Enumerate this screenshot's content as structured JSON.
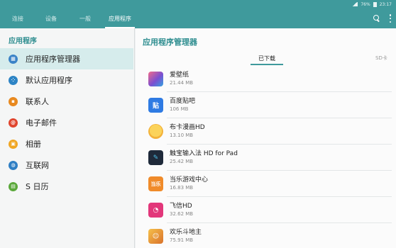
{
  "statusbar": {
    "time": "23:17",
    "battery": "76%"
  },
  "header": {
    "tabs": [
      {
        "label": "连接",
        "active": false
      },
      {
        "label": "设备",
        "active": false
      },
      {
        "label": "一般",
        "active": false
      },
      {
        "label": "应用程序",
        "active": true
      }
    ],
    "search_icon": "search-icon",
    "more_icon": "more-vertical-icon"
  },
  "left": {
    "title": "应用程序",
    "items": [
      {
        "label": "应用程序管理器",
        "icon": "grid-icon",
        "color": "#3b83c7",
        "selected": true
      },
      {
        "label": "默认应用程序",
        "icon": "apps-icon",
        "color": "#2d84c5",
        "selected": false
      },
      {
        "label": "联系人",
        "icon": "contact-icon",
        "color": "#e8891f",
        "selected": false
      },
      {
        "label": "电子邮件",
        "icon": "email-icon",
        "color": "#e0452e",
        "selected": false
      },
      {
        "label": "相册",
        "icon": "gallery-icon",
        "color": "#f0a623",
        "selected": false
      },
      {
        "label": "互联网",
        "icon": "globe-icon",
        "color": "#2f7fc4",
        "selected": false
      },
      {
        "label": "S 日历",
        "icon": "calendar-icon",
        "color": "#5aa83a",
        "selected": false
      }
    ]
  },
  "right": {
    "title": "应用程序管理器",
    "subtabs": {
      "downloaded": "已下载",
      "sd": "SD卡"
    },
    "apps": [
      {
        "name": "爱壁纸",
        "size": "21.44 MB",
        "icon": "wallpaper-app-icon",
        "color": "#e14a6f",
        "glyph": ""
      },
      {
        "name": "百度贴吧",
        "size": "106 MB",
        "icon": "tieba-app-icon",
        "color": "#2f7be3",
        "glyph": "贴"
      },
      {
        "name": "布卡漫画HD",
        "size": "13.10 MB",
        "icon": "buka-app-icon",
        "color": "#f3b23a",
        "glyph": ""
      },
      {
        "name": "触宝输入法 HD for Pad",
        "size": "25.42 MB",
        "icon": "touchpal-app-icon",
        "color": "#1f2a3a",
        "glyph": ""
      },
      {
        "name": "当乐游戏中心",
        "size": "16.83 MB",
        "icon": "dangle-app-icon",
        "color": "#f08b2a",
        "glyph": "当乐"
      },
      {
        "name": "飞信HD",
        "size": "32.62 MB",
        "icon": "fetion-app-icon",
        "color": "#e2377a",
        "glyph": ""
      },
      {
        "name": "欢乐斗地主",
        "size": "75.91 MB",
        "icon": "doudizhu-app-icon",
        "color": "#e8a23b",
        "glyph": ""
      }
    ]
  }
}
